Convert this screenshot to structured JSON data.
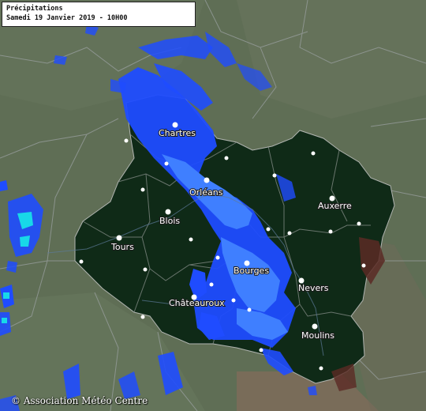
{
  "title": {
    "line1": "Précipitations",
    "line2": "Samedi 19 Janvier 2019 - 10H00"
  },
  "copyright": "© Association Météo Centre",
  "cities": [
    {
      "name": "Chartres",
      "labeled": true
    },
    {
      "name": "Orléans",
      "labeled": true
    },
    {
      "name": "Blois",
      "labeled": true
    },
    {
      "name": "Tours",
      "labeled": true
    },
    {
      "name": "Bourges",
      "labeled": true
    },
    {
      "name": "Châteauroux",
      "labeled": true
    },
    {
      "name": "Nevers",
      "labeled": true
    },
    {
      "name": "Auxerre",
      "labeled": true
    },
    {
      "name": "Moulins",
      "labeled": true
    }
  ],
  "colors": {
    "region_fill": "#0f2a17",
    "outside_fill": "#5f6e55",
    "precip_light": "#1f4cff",
    "precip_moderate": "#3f7fff",
    "precip_heavy": "#18d8e8",
    "borders": "#9aa0a0"
  }
}
